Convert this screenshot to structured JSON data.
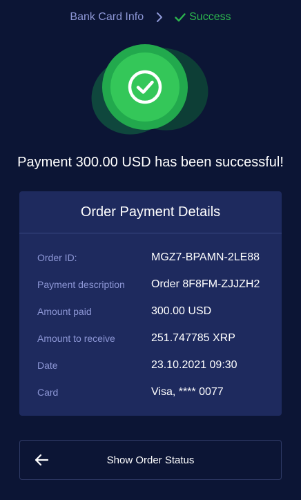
{
  "breadcrumb": {
    "previous": "Bank Card Info",
    "current": "Success",
    "icons": {
      "separator": "chevron-right-icon",
      "current": "check-icon"
    }
  },
  "hero": {
    "icon": "check-circle-icon",
    "accent_color": "#34c759"
  },
  "message": "Payment 300.00 USD has been successful!",
  "details": {
    "title": "Order Payment Details",
    "rows": [
      {
        "label": "Order ID:",
        "value": "MGZ7-BPAMN-2LE88"
      },
      {
        "label": "Payment description",
        "value": "Order 8F8FM-ZJJZH2"
      },
      {
        "label": "Amount paid",
        "value": "300.00 USD"
      },
      {
        "label": "Amount to receive",
        "value": "251.747785 XRP"
      },
      {
        "label": "Date",
        "value": "23.10.2021 09:30"
      },
      {
        "label": "Card",
        "value": "Visa, **** 0077"
      }
    ]
  },
  "status_button": {
    "label": "Show Order Status",
    "icon": "arrow-left-icon"
  },
  "colors": {
    "background": "#0c1535",
    "card": "#1e2a5e",
    "label": "#8d97d6",
    "success": "#2cb54e"
  }
}
